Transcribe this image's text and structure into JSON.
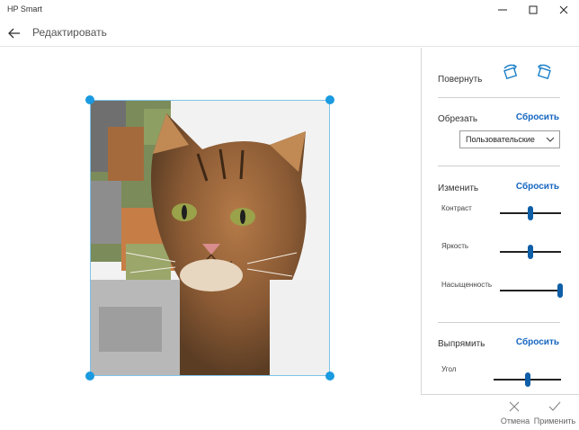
{
  "window": {
    "app_title": "HP Smart",
    "controls": [
      "minimize-icon",
      "maximize-icon",
      "close-icon"
    ]
  },
  "nav": {
    "back_icon": "back-arrow-icon",
    "title": "Редактировать"
  },
  "panel": {
    "rotate": {
      "title": "Повернуть",
      "icons": [
        "rotate-right-icon",
        "rotate-left-icon"
      ]
    },
    "crop": {
      "title": "Обрезать",
      "reset_label": "Сбросить",
      "dropdown_value": "Пользовательские"
    },
    "adjust": {
      "title": "Изменить",
      "reset_label": "Сбросить",
      "sliders": [
        {
          "label": "Контраст",
          "value": 0.5
        },
        {
          "label": "Яркость",
          "value": 0.5
        },
        {
          "label": "Насыщенность",
          "value": 0.98
        }
      ]
    },
    "straighten": {
      "title": "Выпрямить",
      "reset_label": "Сбросить",
      "slider": {
        "label": "Угол",
        "value": 0.5
      }
    }
  },
  "footer": {
    "cancel_label": "Отмена",
    "apply_label": "Применить"
  },
  "colors": {
    "accent": "#1565c0",
    "handle": "#1a9ae0",
    "slider_thumb": "#0e5ea8"
  }
}
